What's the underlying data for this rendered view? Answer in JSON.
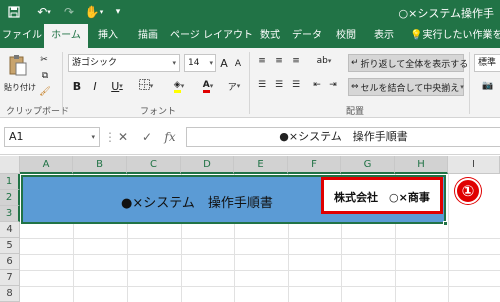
{
  "titlebar": {
    "save_icon": "save-icon",
    "undo_icon": "undo-icon",
    "redo_icon": "redo-icon",
    "touch_icon": "touch-mode-icon",
    "customize_icon": "customize-qat-icon",
    "title": "○×システム操作手"
  },
  "ribbon_tabs": [
    {
      "label": "ファイル"
    },
    {
      "label": "ホーム"
    },
    {
      "label": "挿入"
    },
    {
      "label": "描画"
    },
    {
      "label": "ページ レイアウト"
    },
    {
      "label": "数式"
    },
    {
      "label": "データ"
    },
    {
      "label": "校閲"
    },
    {
      "label": "表示"
    },
    {
      "label": "実行したい作業を入"
    }
  ],
  "active_tab": "ホーム",
  "ribbon": {
    "clipboard": {
      "paste_label": "貼り付け",
      "group_label": "クリップボード"
    },
    "font": {
      "font_name": "游ゴシック",
      "font_size": "14",
      "bold": "B",
      "italic": "I",
      "underline": "U",
      "grow": "A",
      "shrink": "A",
      "font_color_letter": "A",
      "furigana": "ア",
      "group_label": "フォント"
    },
    "alignment": {
      "wrap_label": "折り返して全体を表示する",
      "merge_label": "セルを結合して中央揃え",
      "group_label": "配置"
    },
    "number": {
      "format_label": "標準"
    }
  },
  "formula_bar": {
    "name_box": "A1",
    "cancel": "✕",
    "enter": "✓",
    "fx": "fx",
    "formula": "●×システム　操作手順書"
  },
  "grid": {
    "columns": [
      "A",
      "B",
      "C",
      "D",
      "E",
      "F",
      "G",
      "H",
      "I"
    ],
    "rows": [
      "1",
      "2",
      "3",
      "4",
      "5",
      "6",
      "7",
      "8"
    ],
    "merged_cell_text": "●×システム　操作手順書",
    "company_text": "株式会社　○×商事",
    "banner_color": "#5b9bd5"
  },
  "annotation": {
    "callout_label": "①",
    "callout_color": "#e00000"
  }
}
